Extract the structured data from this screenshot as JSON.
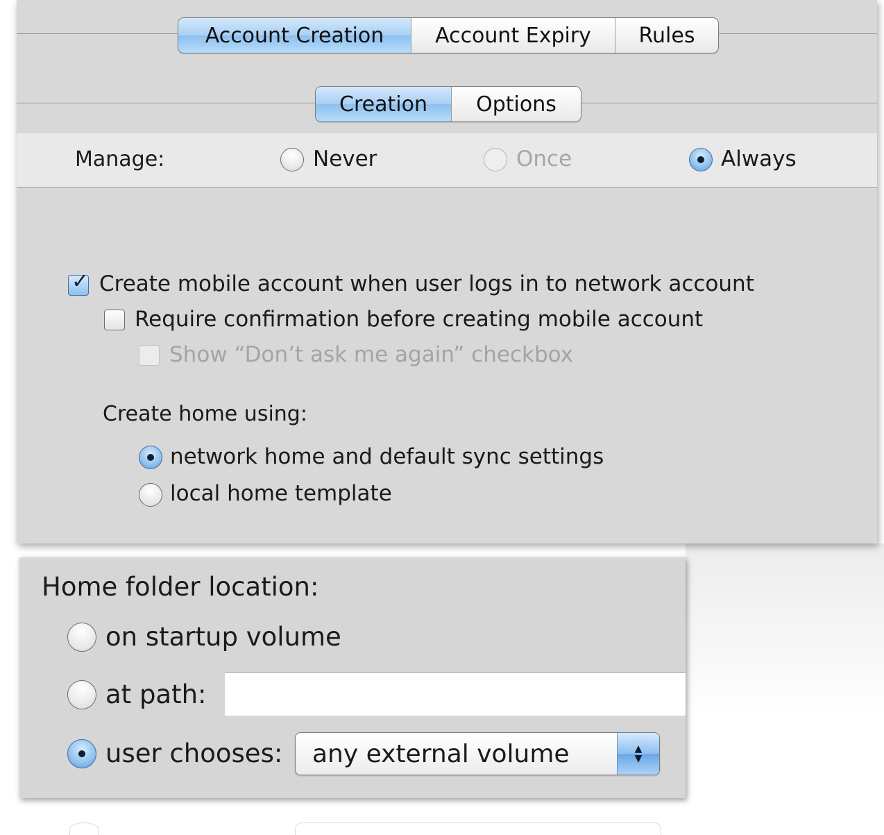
{
  "top_tabs": [
    {
      "label": "Account Creation",
      "selected": true
    },
    {
      "label": "Account Expiry",
      "selected": false
    },
    {
      "label": "Rules",
      "selected": false
    }
  ],
  "sub_tabs": [
    {
      "label": "Creation",
      "selected": true
    },
    {
      "label": "Options",
      "selected": false
    }
  ],
  "manage": {
    "label": "Manage:",
    "options": [
      {
        "label": "Never",
        "selected": false,
        "enabled": true
      },
      {
        "label": "Once",
        "selected": false,
        "enabled": false
      },
      {
        "label": "Always",
        "selected": true,
        "enabled": true
      }
    ]
  },
  "creation": {
    "create_mobile": {
      "label": "Create mobile account when user logs in to network account",
      "checked": true
    },
    "require_confirmation": {
      "label": "Require confirmation before creating mobile account",
      "checked": false
    },
    "show_dont_ask": {
      "label": "Show “Don’t ask me again” checkbox",
      "checked": false,
      "enabled": false
    },
    "home_using_label": "Create home using:",
    "home_using_options": [
      {
        "label": "network home and default sync settings",
        "selected": true
      },
      {
        "label": "local home template",
        "selected": false
      }
    ]
  },
  "home_folder": {
    "label": "Home folder location:",
    "options": [
      {
        "label": "on startup volume",
        "selected": false
      },
      {
        "label": "at path:",
        "selected": false
      },
      {
        "label": "user chooses:",
        "selected": true
      }
    ],
    "path_value": "",
    "chooser_value": "any external volume"
  }
}
